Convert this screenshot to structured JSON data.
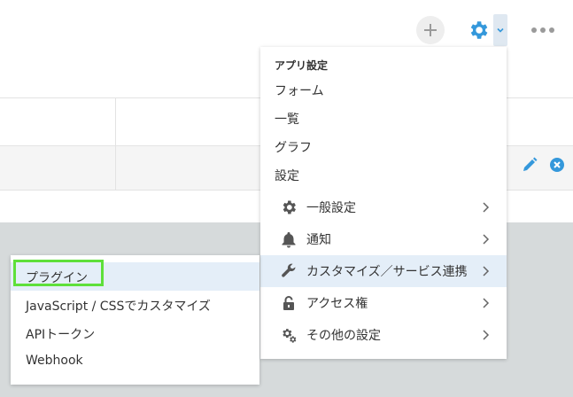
{
  "colors": {
    "accent": "#3498db",
    "highlight": "#5ee03a",
    "menu_active_bg": "#e4eef8",
    "gray_area": "#d6dadb"
  },
  "toolbar": {
    "add_icon": "plus-icon",
    "settings_icon": "gear-icon",
    "dropdown_icon": "chevron-down-icon",
    "more_icon": "ellipsis-icon"
  },
  "row_actions": {
    "edit_icon": "pencil-icon",
    "delete_icon": "close-circle-icon"
  },
  "menu": {
    "header": "アプリ設定",
    "plain_items": [
      "フォーム",
      "一覧",
      "グラフ",
      "設定"
    ],
    "items": [
      {
        "label": "一般設定",
        "icon": "gear-icon"
      },
      {
        "label": "通知",
        "icon": "bell-icon"
      },
      {
        "label": "カスタマイズ／サービス連携",
        "icon": "wrench-icon"
      },
      {
        "label": "アクセス権",
        "icon": "lock-icon"
      },
      {
        "label": "その他の設定",
        "icon": "gears-icon"
      }
    ]
  },
  "submenu": {
    "items": [
      {
        "label": "プラグイン"
      },
      {
        "label": "JavaScript / CSSでカスタマイズ"
      },
      {
        "label": "APIトークン"
      },
      {
        "label": "Webhook"
      }
    ]
  }
}
